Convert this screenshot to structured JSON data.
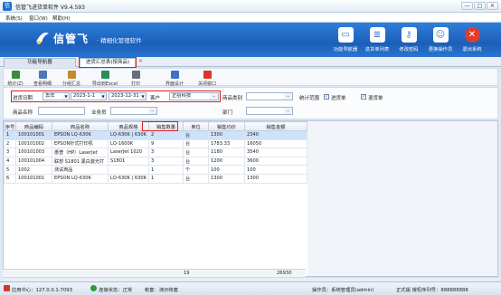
{
  "window": {
    "title": "信管飞进货单软件 V9.4.593",
    "min": "—",
    "max": "□",
    "close": "✕"
  },
  "menu": [
    {
      "label": "系统(S)"
    },
    {
      "label": "窗口(W)"
    },
    {
      "label": "帮助(H)"
    }
  ],
  "banner": {
    "logo": "信管飞",
    "slogan": "· 精细化管理软件",
    "buttons": [
      {
        "label": "功能导航器",
        "icon": "monitor-icon",
        "glyph": "▭",
        "color": "#2d6fc4"
      },
      {
        "label": "进货单列表",
        "icon": "list-icon",
        "glyph": "≣",
        "color": "#2d6fc4"
      },
      {
        "label": "修改密码",
        "icon": "key-icon",
        "glyph": "⚷",
        "color": "#4a8de0"
      },
      {
        "label": "更换操作员",
        "icon": "user-icon",
        "glyph": "☺",
        "color": "#3a7fd6"
      },
      {
        "label": "退出系统",
        "icon": "exit-icon",
        "glyph": "✕",
        "color": "#e23b2f"
      }
    ]
  },
  "tabs": [
    {
      "label": "功能导航器"
    },
    {
      "label": "进货汇总表(按商品)",
      "close": "×"
    }
  ],
  "toolbar": [
    {
      "label": "统计(Z)",
      "icon": "chart-icon",
      "color": "#3c8a3c"
    },
    {
      "label": "查看明细",
      "icon": "detail-icon",
      "color": "#4a77b5"
    },
    {
      "label": "分组汇总",
      "icon": "group-icon",
      "color": "#c58a2a"
    },
    {
      "label": "导出到Excel",
      "icon": "excel-icon",
      "color": "#2e8b57"
    },
    {
      "label": "打印",
      "icon": "printer-icon",
      "color": "#666f7a"
    },
    {
      "label": "界面设计",
      "icon": "design-icon",
      "color": "#3d73c2"
    },
    {
      "label": "关闭窗口",
      "icon": "close-window-icon",
      "color": "#d9362b"
    }
  ],
  "filters": {
    "date_label": "进货日期",
    "period": "去年",
    "date_from": "2023-1-1",
    "date_to": "2023-12-31",
    "customer_label": "客户",
    "customer_value": "正招科技",
    "category_label": "商品类别",
    "stat_label": "统计范围",
    "opt1": "进货单",
    "opt2": "退货单",
    "product_label": "商品名称",
    "salesman_label": "业务员",
    "dept_label": "部门",
    "more": "···",
    "arrow": "▼",
    "check": "✓"
  },
  "table": {
    "columns": [
      "序号",
      "商品编码",
      "商品名称",
      "商品规格",
      "销售数量",
      "单位",
      "销售均价",
      "销售金额"
    ],
    "rows": [
      [
        "1",
        "100101001",
        "EPSON LQ-630K",
        "LQ-630K | 630K",
        "2",
        "台",
        "1300",
        "2340"
      ],
      [
        "2",
        "100101002",
        "EPSON针式打印机",
        "LQ-1600K",
        "9",
        "台",
        "1783.33",
        "16050"
      ],
      [
        "3",
        "100101003",
        "惠普（HP）LaserJet",
        "LaserJet 1020",
        "3",
        "台",
        "1180",
        "3540"
      ],
      [
        "4",
        "100101004",
        "联想 S1801 黑白激光打",
        "S1801",
        "3",
        "台",
        "1200",
        "3600"
      ],
      [
        "5",
        "1002",
        "测试商品",
        "",
        "1",
        "个",
        "100",
        "100"
      ],
      [
        "6",
        "100101001",
        "EPSON LQ-630K",
        "LQ-630K | 630K",
        "1",
        "台",
        "1300",
        "1300"
      ]
    ],
    "total_qty": "19",
    "total_amount": "26930"
  },
  "status": {
    "app_center": "应用中心：127.0.0.1:7093",
    "connection": "连接状态：正常",
    "account_set": "帐套：演示帐套",
    "operator": "操作员：系统管理员(admin)",
    "license": "正式版 授权序列号：888888888"
  }
}
